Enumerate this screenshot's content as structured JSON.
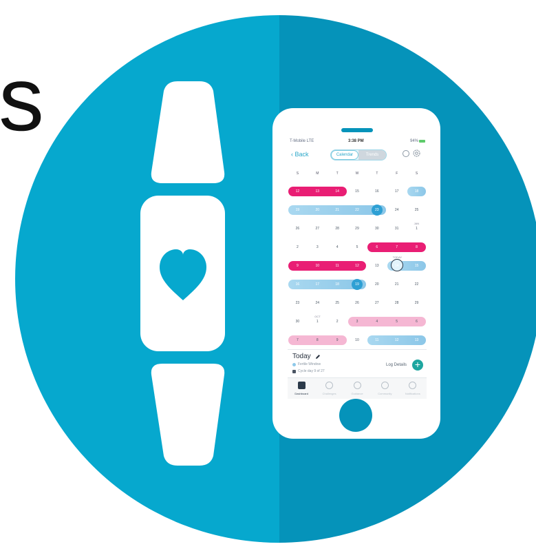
{
  "partial_heading": "s",
  "colors": {
    "circle_light": "#06A8CE",
    "circle_dark": "#0593BA",
    "white": "#FFFFFF",
    "period": "#E91E74",
    "fertile": "#8CC7E8",
    "pms": "#F5B7D3",
    "accent": "#1EA6A0"
  },
  "icons": {
    "band": "fitness-tracker-icon",
    "heart": "heart-icon",
    "phone": "smartphone-icon"
  },
  "status_bar": {
    "carrier": "T-Mobile LTE",
    "time": "3:38 PM",
    "battery": "94%"
  },
  "nav": {
    "back_label": "Back",
    "tabs": [
      "Calendar",
      "Trends"
    ]
  },
  "weekdays": [
    "S",
    "M",
    "T",
    "W",
    "T",
    "F",
    "S"
  ],
  "weeks": [
    {
      "days": [
        "12",
        "13",
        "14",
        "15",
        "16",
        "17",
        "18"
      ]
    },
    {
      "days": [
        "19",
        "20",
        "21",
        "22",
        "23",
        "24",
        "25"
      ]
    },
    {
      "days": [
        "26",
        "27",
        "28",
        "29",
        "30",
        "31",
        "1"
      ],
      "month_tag": "JAN"
    },
    {
      "days": [
        "2",
        "3",
        "4",
        "5",
        "6",
        "7",
        "8"
      ]
    },
    {
      "days": [
        "9",
        "10",
        "11",
        "12",
        "13",
        "14",
        "15"
      ],
      "today_label": "TODAY"
    },
    {
      "days": [
        "16",
        "17",
        "18",
        "19",
        "20",
        "21",
        "22"
      ]
    },
    {
      "days": [
        "23",
        "24",
        "25",
        "26",
        "27",
        "28",
        "29"
      ]
    },
    {
      "days": [
        "30",
        "1",
        "2",
        "3",
        "4",
        "5",
        "6"
      ],
      "month_tag": "OCT"
    },
    {
      "days": [
        "7",
        "8",
        "9",
        "10",
        "11",
        "12",
        "13"
      ]
    }
  ],
  "today": {
    "title": "Today",
    "fertile_window": "Fertile Window",
    "cycle_day": "Cycle day 9 of 27",
    "log_details": "Log Details",
    "add_symbol": "+"
  },
  "tabbar": [
    "Dashboard",
    "Challenges",
    "Guidance",
    "Community",
    "Notifications"
  ]
}
